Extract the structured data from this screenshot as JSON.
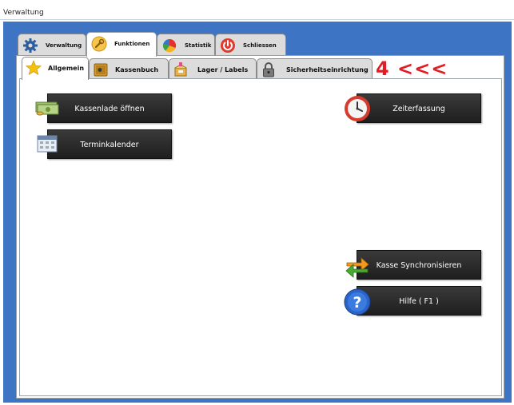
{
  "window": {
    "title": "Verwaltung"
  },
  "main_tabs": [
    {
      "label": "Verwaltung",
      "icon": "gear-icon"
    },
    {
      "label": "Funktionen",
      "icon": "wrench-icon"
    },
    {
      "label": "Statistik",
      "icon": "pie-chart-icon"
    },
    {
      "label": "Schliessen",
      "icon": "power-icon"
    }
  ],
  "sub_tabs": [
    {
      "label": "Allgemein",
      "icon": "star-icon"
    },
    {
      "label": "Kassenbuch",
      "icon": "safe-icon"
    },
    {
      "label": "Lager / Labels",
      "icon": "box-icon"
    },
    {
      "label": "Sicherheitseinrichtung",
      "icon": "padlock-icon"
    }
  ],
  "annotation": "4 <<<",
  "buttons": {
    "kassenlade": {
      "label": "Kassenlade öffnen",
      "icon": "money-icon"
    },
    "termin": {
      "label": "Terminkalender",
      "icon": "calendar-icon"
    },
    "zeit": {
      "label": "Zeiterfassung",
      "icon": "clock-icon"
    },
    "sync": {
      "label": "Kasse Synchronisieren",
      "icon": "sync-arrows-icon"
    },
    "hilfe": {
      "label": "Hilfe ( F1 )",
      "icon": "help-icon"
    }
  },
  "colors": {
    "frame": "#3e74c4",
    "button": "#2b2b2b",
    "annotation": "#e21d25"
  }
}
